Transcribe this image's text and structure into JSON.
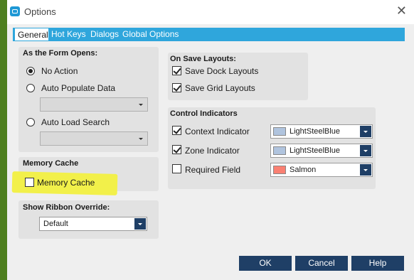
{
  "window": {
    "title": "Options",
    "close_glyph": "✕"
  },
  "tabs": [
    {
      "label": "General",
      "active": true
    },
    {
      "label": "Hot Keys"
    },
    {
      "label": "Dialogs"
    },
    {
      "label": "Global Options"
    }
  ],
  "form_opens": {
    "title": "As the Form Opens:",
    "no_action": "No Action",
    "auto_populate": "Auto Populate Data",
    "auto_load": "Auto Load Search",
    "selected": "no_action"
  },
  "memory_cache": {
    "title": "Memory Cache",
    "checkbox_label": "Memory Cache",
    "checked": false,
    "highlight_color": "#f2f04a"
  },
  "ribbon": {
    "title": "Show Ribbon Override:",
    "value": "Default"
  },
  "save_layouts": {
    "title": "On Save Layouts:",
    "dock_label": "Save Dock Layouts",
    "grid_label": "Save Grid Layouts",
    "dock_checked": true,
    "grid_checked": true
  },
  "indicators": {
    "title": "Control Indicators",
    "items": [
      {
        "label": "Context Indicator",
        "checked": true,
        "color_name": "LightSteelBlue",
        "color": "#b0c4de"
      },
      {
        "label": "Zone Indicator",
        "checked": true,
        "color_name": "LightSteelBlue",
        "color": "#b0c4de"
      },
      {
        "label": "Required Field",
        "checked": false,
        "color_name": "Salmon",
        "color": "#fa8072"
      }
    ]
  },
  "buttons": {
    "ok": "OK",
    "cancel": "Cancel",
    "help": "Help"
  },
  "colors": {
    "accent": "#2fa6dc",
    "button": "#1f3f66",
    "left_strip": "#4e7f1f"
  }
}
